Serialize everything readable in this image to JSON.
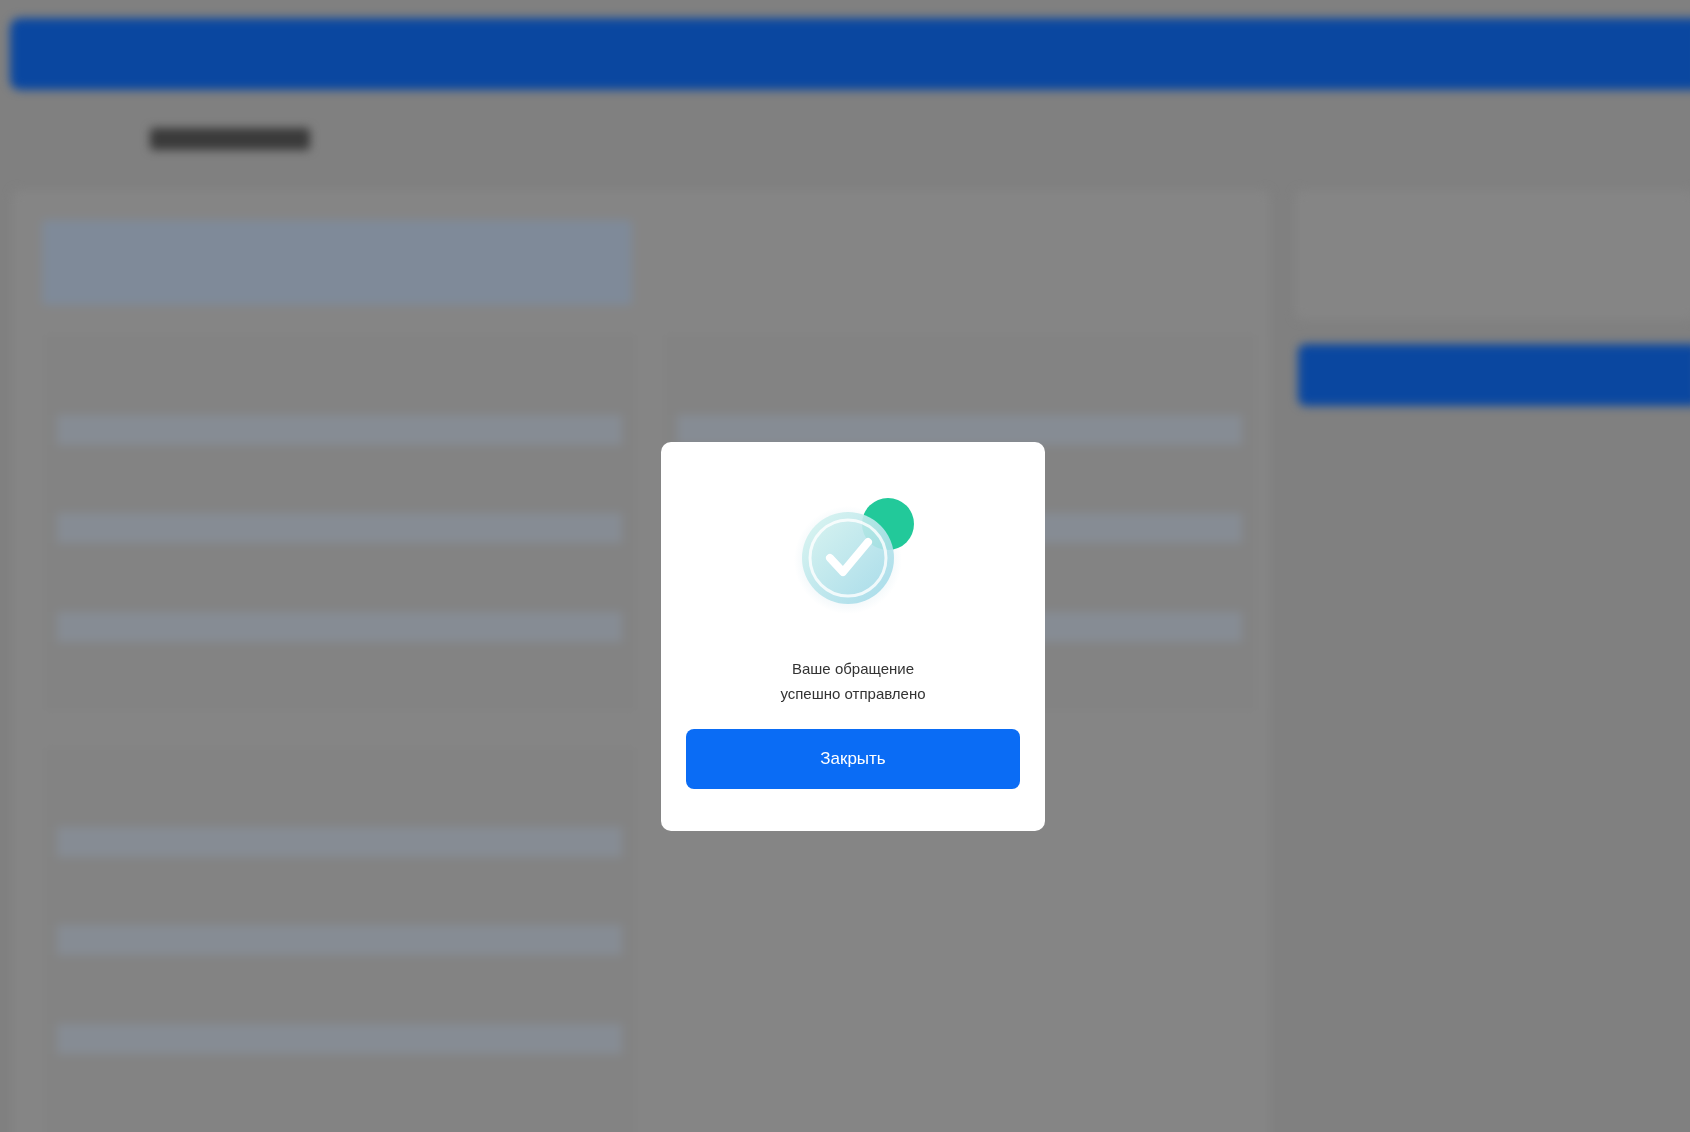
{
  "dialog": {
    "message": "Ваше обращение успешно отправлено",
    "button": "Закрыть"
  }
}
